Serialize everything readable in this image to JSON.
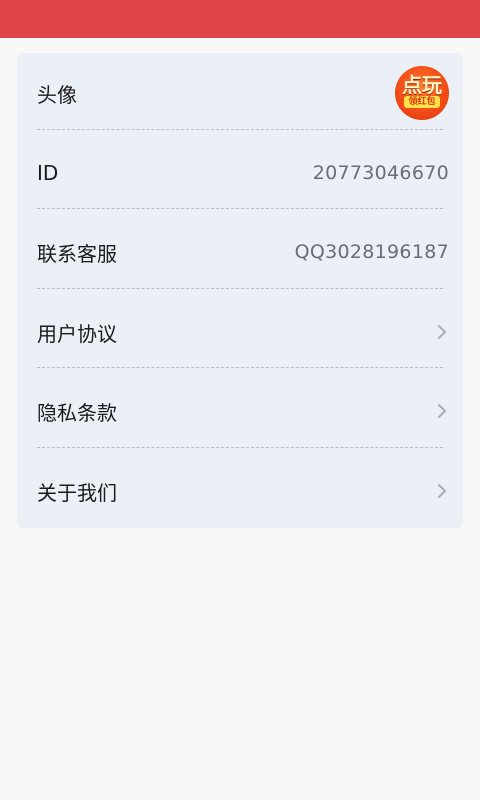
{
  "colors": {
    "status_bar": "#e2434a",
    "card_bg": "#ebf0f7",
    "page_bg": "#f9f8f9"
  },
  "settings": {
    "avatar": {
      "label": "头像",
      "logo_text": "点玩",
      "logo_subtext": "领红包"
    },
    "id": {
      "label": "ID",
      "value": "20773046670"
    },
    "support": {
      "label": "联系客服",
      "value": "QQ3028196187"
    },
    "agreement": {
      "label": "用户协议",
      "icon": "chevron-right-icon"
    },
    "privacy": {
      "label": "隐私条款",
      "icon": "chevron-right-icon"
    },
    "about": {
      "label": "关于我们",
      "icon": "chevron-right-icon"
    }
  }
}
